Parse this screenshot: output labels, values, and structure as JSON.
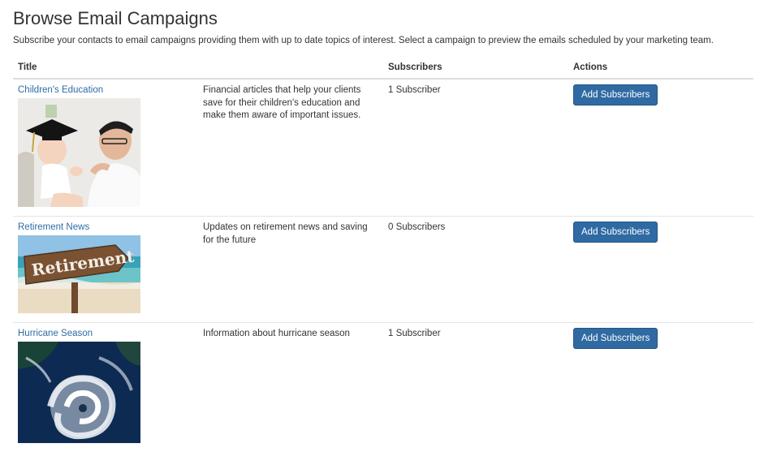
{
  "page": {
    "title": "Browse Email Campaigns",
    "intro": "Subscribe your contacts to email campaigns providing them with up to date topics of interest. Select a campaign to preview the emails scheduled by your marketing team."
  },
  "table": {
    "headers": [
      "Title",
      "",
      "Subscribers",
      "Actions"
    ],
    "rows": [
      {
        "title": "Children's Education",
        "image_icon": "graduation-photo",
        "description": "Financial articles that help your clients save for their children's education and make them aware of important issues.",
        "subscribers": "1 Subscriber",
        "action": "Add Subscribers"
      },
      {
        "title": "Retirement News",
        "image_icon": "retirement-sign-photo",
        "image_text": "Retirement",
        "description": "Updates on retirement news and saving for the future",
        "subscribers": "0 Subscribers",
        "action": "Add Subscribers"
      },
      {
        "title": "Hurricane Season",
        "image_icon": "hurricane-satellite-photo",
        "description": "Information about hurricane season",
        "subscribers": "1 Subscriber",
        "action": "Add Subscribers"
      }
    ]
  },
  "colors": {
    "link": "#2e6da4",
    "button": "#2f6aa3",
    "text": "#333333"
  }
}
